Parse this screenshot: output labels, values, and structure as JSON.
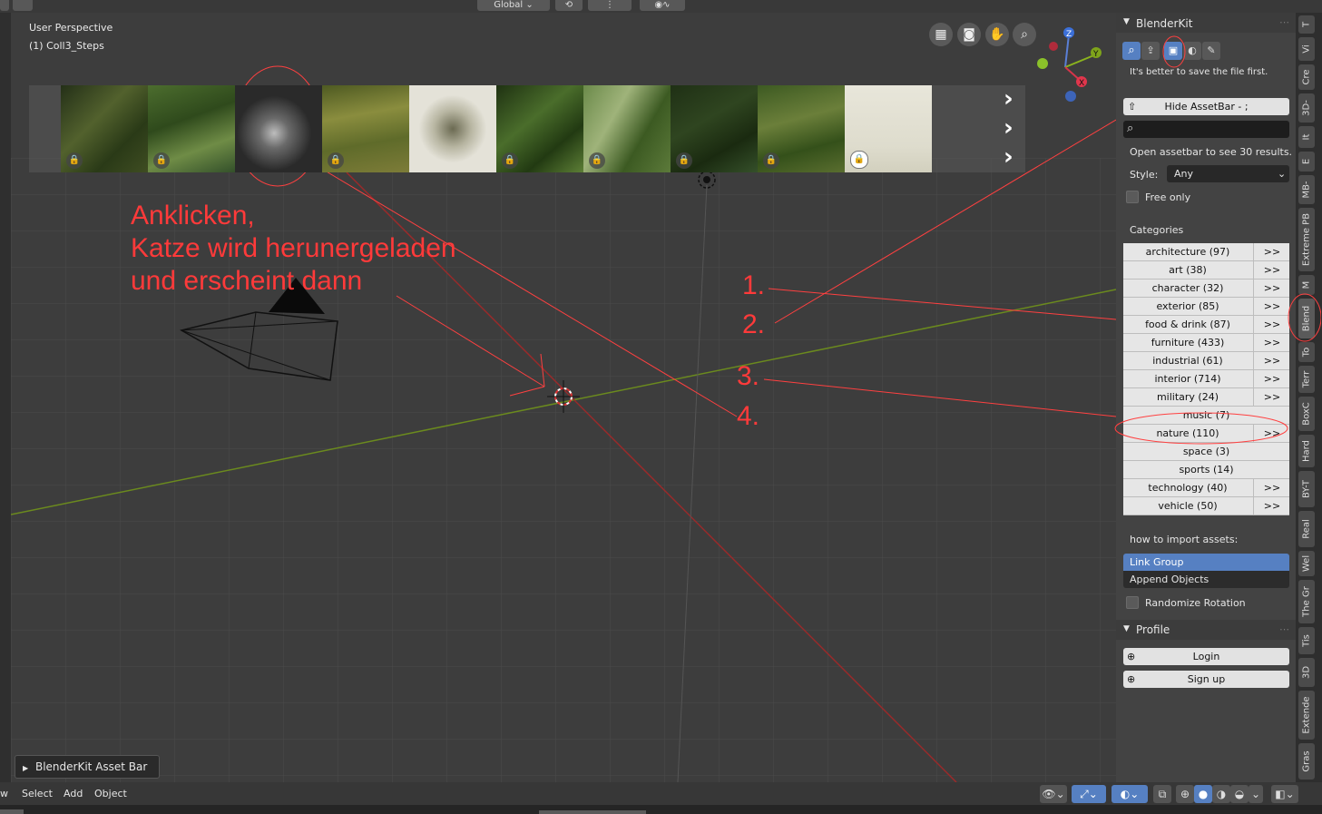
{
  "header": {
    "orientation": "Global"
  },
  "viewport": {
    "perspective": "User Perspective",
    "collection": "(1) Coll3_Steps",
    "asset_bar_panel": "BlenderKit Asset Bar UI"
  },
  "annotations": {
    "line1": "Anklicken,",
    "line2": "Katze wird herunergeladen",
    "line3": "und erscheint dann",
    "steps": [
      "1.",
      "2.",
      "3.",
      "4."
    ]
  },
  "gizmo": {
    "z": "Z",
    "y": "Y",
    "x": "X"
  },
  "panel": {
    "title": "BlenderKit",
    "save_hint": "It's better to save the file first.",
    "hide_assetbar": "Hide AssetBar - ;",
    "search_placeholder": "",
    "results_text": "Open assetbar to see 30 results.",
    "style_label": "Style:",
    "style_value": "Any",
    "free_only": "Free only",
    "categories_title": "Categories",
    "categories": [
      {
        "label": "architecture (97)",
        "go": ">>"
      },
      {
        "label": "art (38)",
        "go": ">>"
      },
      {
        "label": "character (32)",
        "go": ">>"
      },
      {
        "label": "exterior (85)",
        "go": ">>"
      },
      {
        "label": "food & drink (87)",
        "go": ">>"
      },
      {
        "label": "furniture (433)",
        "go": ">>"
      },
      {
        "label": "industrial (61)",
        "go": ">>"
      },
      {
        "label": "interior (714)",
        "go": ">>"
      },
      {
        "label": "military (24)",
        "go": ">>"
      },
      {
        "label": "music (7)",
        "go": ""
      },
      {
        "label": "nature (110)",
        "go": ">>"
      },
      {
        "label": "space (3)",
        "go": ""
      },
      {
        "label": "sports (14)",
        "go": ""
      },
      {
        "label": "technology (40)",
        "go": ">>"
      },
      {
        "label": "vehicle (50)",
        "go": ">>"
      }
    ],
    "import_title": "how to import assets:",
    "link_group": "Link Group",
    "append_objects": "Append Objects",
    "randomize_rotation": "Randomize Rotation",
    "profile_title": "Profile",
    "login": "Login",
    "signup": "Sign up"
  },
  "tabs": [
    "T",
    "Vi",
    "Cre",
    "3D-",
    "It",
    "E",
    "MB-",
    "Extreme PB",
    "M",
    "Blend",
    "To",
    "Terr",
    "BoxC",
    "Hard",
    "BY-T",
    "Real",
    "Wel",
    "The Gr",
    "Tis",
    "3D",
    "Extende",
    "Gras"
  ],
  "bottom": {
    "menu": [
      "w",
      "Select",
      "Add",
      "Object"
    ]
  },
  "colors": {
    "accent": "#5680c2",
    "annotation": "#ff3a3a"
  }
}
